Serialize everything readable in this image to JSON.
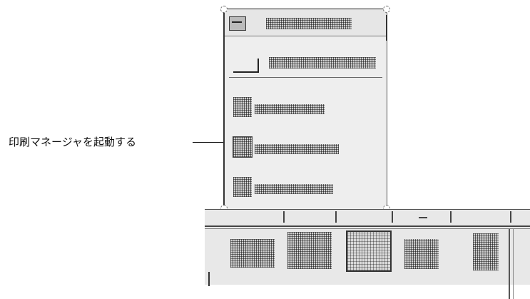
{
  "callout": {
    "text": "印刷マネージャを起動する"
  },
  "subpanel": {
    "items": [
      "",
      "",
      ""
    ]
  },
  "icons": {
    "menu": "subpanel-menu-icon",
    "install": "install-icon-drop-zone",
    "printers": "printer-icon"
  }
}
